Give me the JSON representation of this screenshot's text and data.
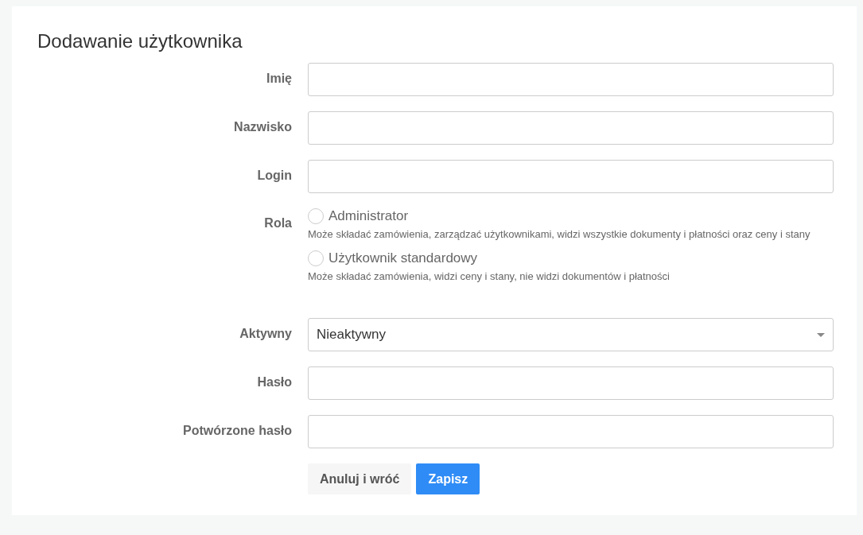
{
  "title": "Dodawanie użytkownika",
  "fields": [
    {
      "kind": "text",
      "label": "Imię"
    },
    {
      "kind": "text",
      "label": "Nazwisko"
    },
    {
      "kind": "text",
      "label": "Login"
    },
    {
      "kind": "radio",
      "label": "Rola",
      "options": [
        {
          "label": "Administrator",
          "description": "Może składać zamówienia, zarządzać użytkownikami, widzi wszystkie dokumenty i płatności oraz ceny i stany",
          "selected": false
        },
        {
          "label": "Użytkownik standardowy",
          "description": "Może składać zamówienia, widzi ceny i stany, nie widzi dokumentów i płatności",
          "selected": false
        }
      ]
    },
    {
      "kind": "select",
      "label": "Aktywny",
      "value": "Nieaktywny"
    },
    {
      "kind": "text",
      "label": "Hasło"
    },
    {
      "kind": "text",
      "label": "Potwórzone hasło"
    }
  ],
  "buttons": [
    {
      "kind": "secondary",
      "label": "Anuluj i wróć"
    },
    {
      "kind": "primary",
      "label": "Zapisz"
    }
  ]
}
